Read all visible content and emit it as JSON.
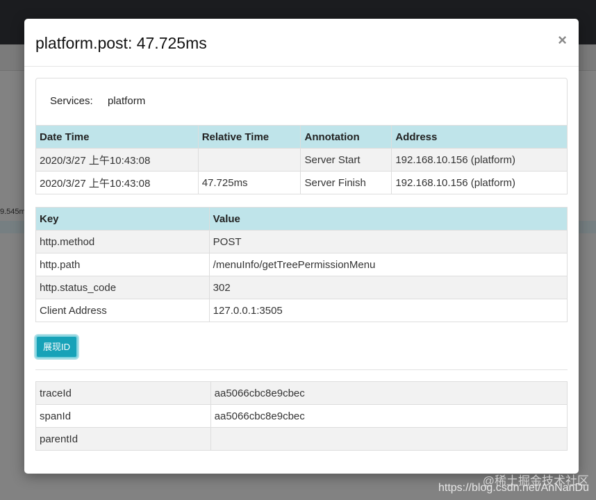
{
  "background": {
    "side_label": "9.545m"
  },
  "modal": {
    "title": "platform.post: 47.725ms",
    "close_label": "×",
    "services": {
      "label": "Services:",
      "value": "platform"
    },
    "annotations": {
      "headers": [
        "Date Time",
        "Relative Time",
        "Annotation",
        "Address"
      ],
      "rows": [
        [
          "2020/3/27 上午10:43:08",
          "",
          "Server Start",
          "192.168.10.156 (platform)"
        ],
        [
          "2020/3/27 上午10:43:08",
          "47.725ms",
          "Server Finish",
          "192.168.10.156 (platform)"
        ]
      ]
    },
    "tags": {
      "headers": [
        "Key",
        "Value"
      ],
      "rows": [
        [
          "http.method",
          "POST"
        ],
        [
          "http.path",
          "/menuInfo/getTreePermissionMenu"
        ],
        [
          "http.status_code",
          "302"
        ],
        [
          "Client Address",
          "127.0.0.1:3505"
        ]
      ]
    },
    "show_id_button": "展现ID",
    "ids": {
      "rows": [
        [
          "traceId",
          "aa5066cbc8e9cbec"
        ],
        [
          "spanId",
          "aa5066cbc8e9cbec"
        ],
        [
          "parentId",
          ""
        ]
      ]
    }
  },
  "watermark": {
    "line1": "@稀土掘金技术社区",
    "line2": "https://blog.csdn.net/AnNanDu"
  },
  "colors": {
    "header_bg": "#bfe4ea",
    "button_bg": "#17a2b8",
    "overlay": "#828282",
    "topbar": "#1b1c1f"
  }
}
